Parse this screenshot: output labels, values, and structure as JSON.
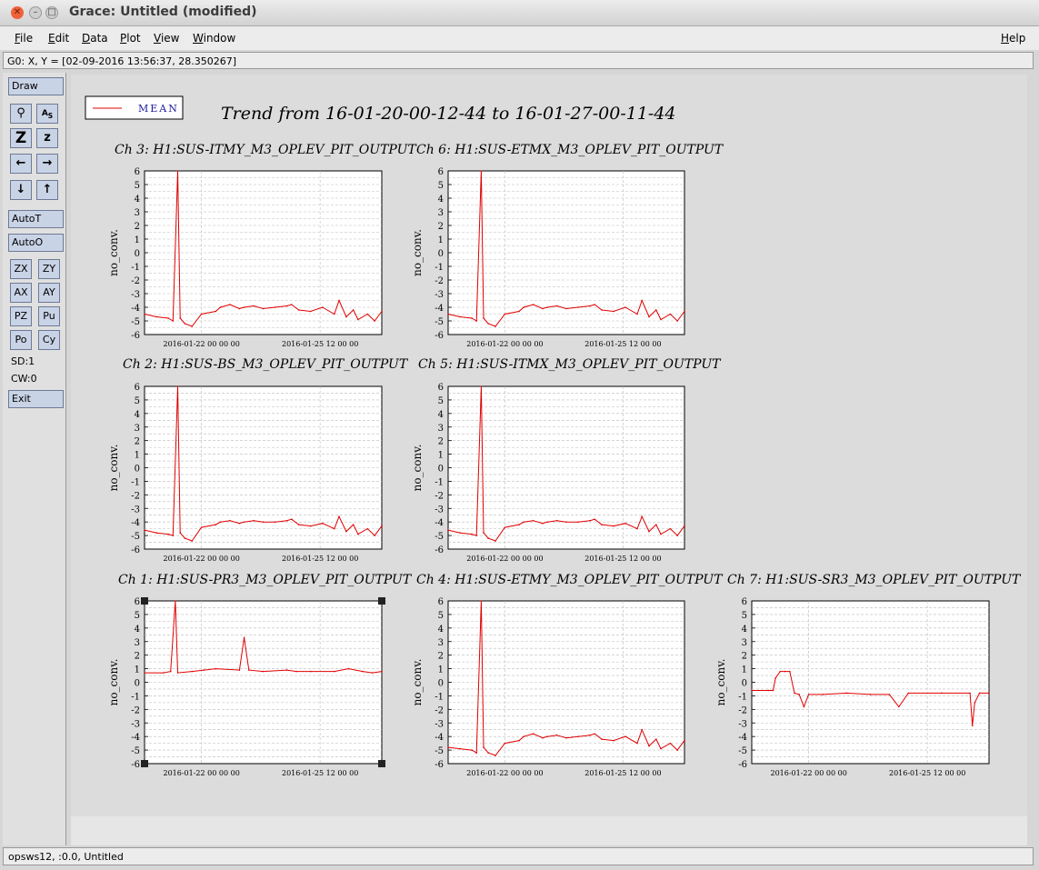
{
  "window": {
    "title": "Grace: Untitled (modified)"
  },
  "menubar": {
    "items": [
      "File",
      "Edit",
      "Data",
      "Plot",
      "View",
      "Window"
    ],
    "help": "Help"
  },
  "coord_readout": "G0: X, Y = [02-09-2016 13:56:37, 28.350267]",
  "toolbar": {
    "draw": "Draw",
    "icon_names": [
      "zoom-icon",
      "text-autoscale-icon",
      "zoom-in-icon",
      "zoom-out-icon",
      "scroll-left-icon",
      "scroll-right-icon",
      "scroll-down-icon",
      "scroll-up-icon"
    ],
    "autot": "AutoT",
    "autoo": "AutoO",
    "buttons": [
      "ZX",
      "ZY",
      "AX",
      "AY",
      "PZ",
      "Pu",
      "Po",
      "Cy"
    ],
    "sd": "SD:1",
    "cw": "CW:0",
    "exit": "Exit"
  },
  "status_bar": "opsws12, :0.0, Untitled",
  "plot": {
    "title": "Trend from 16-01-20-00-12-44 to 16-01-27-00-11-44",
    "legend": "MEAN",
    "line_color": "#e00000",
    "grid_color": "#bbbbbb",
    "y_ticks": [
      "6",
      "5",
      "4",
      "3",
      "2",
      "1",
      "0",
      "-1",
      "-2",
      "-3",
      "-4",
      "-5",
      "-6"
    ],
    "x_ticks": [
      "2016-01-22 00 00 00",
      "2016-01-25 12 00 00"
    ],
    "ylabel": "no_conv."
  },
  "chart_data": [
    {
      "type": "line",
      "title": "Ch 3: H1:SUS-ITMY_M3_OPLEV_PIT_OUTPUT",
      "ylabel": "no_conv.",
      "ylim": [
        -6,
        6
      ],
      "x_ticks": [
        "2016-01-22 00 00 00",
        "2016-01-25 12 00 00"
      ],
      "x": [
        0,
        0.05,
        0.1,
        0.12,
        0.14,
        0.15,
        0.17,
        0.2,
        0.24,
        0.3,
        0.32,
        0.36,
        0.4,
        0.42,
        0.46,
        0.5,
        0.55,
        0.6,
        0.62,
        0.65,
        0.7,
        0.75,
        0.8,
        0.82,
        0.85,
        0.88,
        0.9,
        0.94,
        0.97,
        1.0
      ],
      "series": [
        {
          "name": "MEAN",
          "values": [
            -4.5,
            -4.7,
            -4.8,
            -5.0,
            6.0,
            -4.8,
            -5.2,
            -5.4,
            -4.5,
            -4.3,
            -4.0,
            -3.8,
            -4.1,
            -4.0,
            -3.9,
            -4.1,
            -4.0,
            -3.9,
            -3.8,
            -4.2,
            -4.3,
            -4.0,
            -4.5,
            -3.5,
            -4.7,
            -4.2,
            -4.9,
            -4.5,
            -5.0,
            -4.3
          ]
        }
      ]
    },
    {
      "type": "line",
      "title": "Ch 6: H1:SUS-ETMX_M3_OPLEV_PIT_OUTPUT",
      "ylabel": "no_conv.",
      "ylim": [
        -6,
        6
      ],
      "x_ticks": [
        "2016-01-22 00 00 00",
        "2016-01-25 12 00 00"
      ],
      "x": [
        0,
        0.05,
        0.1,
        0.12,
        0.14,
        0.15,
        0.17,
        0.2,
        0.24,
        0.3,
        0.32,
        0.36,
        0.4,
        0.42,
        0.46,
        0.5,
        0.55,
        0.6,
        0.62,
        0.65,
        0.7,
        0.75,
        0.8,
        0.82,
        0.85,
        0.88,
        0.9,
        0.94,
        0.97,
        1.0
      ],
      "series": [
        {
          "name": "MEAN",
          "values": [
            -4.5,
            -4.7,
            -4.8,
            -5.0,
            6.0,
            -4.8,
            -5.2,
            -5.4,
            -4.5,
            -4.3,
            -4.0,
            -3.8,
            -4.1,
            -4.0,
            -3.9,
            -4.1,
            -4.0,
            -3.9,
            -3.8,
            -4.2,
            -4.3,
            -4.0,
            -4.5,
            -3.5,
            -4.7,
            -4.2,
            -4.9,
            -4.5,
            -5.0,
            -4.3
          ]
        }
      ]
    },
    {
      "type": "line",
      "title": "Ch 2: H1:SUS-BS_M3_OPLEV_PIT_OUTPUT",
      "ylabel": "no_conv.",
      "ylim": [
        -6,
        6
      ],
      "x_ticks": [
        "2016-01-22 00 00 00",
        "2016-01-25 12 00 00"
      ],
      "x": [
        0,
        0.05,
        0.1,
        0.12,
        0.14,
        0.15,
        0.17,
        0.2,
        0.24,
        0.3,
        0.32,
        0.36,
        0.4,
        0.42,
        0.46,
        0.5,
        0.55,
        0.6,
        0.62,
        0.65,
        0.7,
        0.75,
        0.8,
        0.82,
        0.85,
        0.88,
        0.9,
        0.94,
        0.97,
        1.0
      ],
      "series": [
        {
          "name": "MEAN",
          "values": [
            -4.6,
            -4.8,
            -4.9,
            -5.0,
            6.0,
            -4.8,
            -5.2,
            -5.4,
            -4.4,
            -4.2,
            -4.0,
            -3.9,
            -4.1,
            -4.0,
            -3.9,
            -4.0,
            -4.0,
            -3.9,
            -3.8,
            -4.2,
            -4.3,
            -4.1,
            -4.5,
            -3.6,
            -4.7,
            -4.2,
            -4.9,
            -4.5,
            -5.0,
            -4.3
          ]
        }
      ]
    },
    {
      "type": "line",
      "title": "Ch 5: H1:SUS-ITMX_M3_OPLEV_PIT_OUTPUT",
      "ylabel": "no_conv.",
      "ylim": [
        -6,
        6
      ],
      "x_ticks": [
        "2016-01-22 00 00 00",
        "2016-01-25 12 00 00"
      ],
      "x": [
        0,
        0.05,
        0.1,
        0.12,
        0.14,
        0.15,
        0.17,
        0.2,
        0.24,
        0.3,
        0.32,
        0.36,
        0.4,
        0.42,
        0.46,
        0.5,
        0.55,
        0.6,
        0.62,
        0.65,
        0.7,
        0.75,
        0.8,
        0.82,
        0.85,
        0.88,
        0.9,
        0.94,
        0.97,
        1.0
      ],
      "series": [
        {
          "name": "MEAN",
          "values": [
            -4.6,
            -4.8,
            -4.9,
            -5.0,
            6.0,
            -4.8,
            -5.2,
            -5.4,
            -4.4,
            -4.2,
            -4.0,
            -3.9,
            -4.1,
            -4.0,
            -3.9,
            -4.0,
            -4.0,
            -3.9,
            -3.8,
            -4.2,
            -4.3,
            -4.1,
            -4.5,
            -3.6,
            -4.7,
            -4.2,
            -4.9,
            -4.5,
            -5.0,
            -4.3
          ]
        }
      ]
    },
    {
      "type": "line",
      "title": "Ch 1: H1:SUS-PR3_M3_OPLEV_PIT_OUTPUT",
      "ylabel": "no_conv.",
      "ylim": [
        -6,
        6
      ],
      "x_ticks": [
        "2016-01-22 00 00 00",
        "2016-01-25 12 00 00"
      ],
      "x": [
        0,
        0.08,
        0.11,
        0.13,
        0.14,
        0.2,
        0.25,
        0.3,
        0.4,
        0.42,
        0.44,
        0.5,
        0.6,
        0.64,
        0.7,
        0.8,
        0.86,
        0.92,
        0.96,
        1.0
      ],
      "series": [
        {
          "name": "MEAN",
          "values": [
            0.7,
            0.7,
            0.8,
            6.0,
            0.7,
            0.8,
            0.9,
            1.0,
            0.9,
            3.3,
            0.9,
            0.8,
            0.9,
            0.8,
            0.8,
            0.8,
            1.0,
            0.8,
            0.7,
            0.8
          ]
        }
      ]
    },
    {
      "type": "line",
      "title": "Ch 4: H1:SUS-ETMY_M3_OPLEV_PIT_OUTPUT",
      "ylabel": "no_conv.",
      "ylim": [
        -6,
        6
      ],
      "x_ticks": [
        "2016-01-22 00 00 00",
        "2016-01-25 12 00 00"
      ],
      "x": [
        0,
        0.05,
        0.1,
        0.12,
        0.14,
        0.15,
        0.17,
        0.2,
        0.24,
        0.3,
        0.32,
        0.36,
        0.4,
        0.42,
        0.46,
        0.5,
        0.55,
        0.6,
        0.62,
        0.65,
        0.7,
        0.75,
        0.8,
        0.82,
        0.85,
        0.88,
        0.9,
        0.94,
        0.97,
        1.0
      ],
      "series": [
        {
          "name": "MEAN",
          "values": [
            -4.8,
            -4.9,
            -5.0,
            -5.2,
            6.0,
            -4.8,
            -5.2,
            -5.4,
            -4.5,
            -4.3,
            -4.0,
            -3.8,
            -4.1,
            -4.0,
            -3.9,
            -4.1,
            -4.0,
            -3.9,
            -3.8,
            -4.2,
            -4.3,
            -4.0,
            -4.5,
            -3.5,
            -4.7,
            -4.2,
            -4.9,
            -4.5,
            -5.0,
            -4.3
          ]
        }
      ]
    },
    {
      "type": "line",
      "title": "Ch 7: H1:SUS-SR3_M3_OPLEV_PIT_OUTPUT",
      "ylabel": "no_conv.",
      "ylim": [
        -6,
        6
      ],
      "x_ticks": [
        "2016-01-22 00 00 00",
        "2016-01-25 12 00 00"
      ],
      "x": [
        0,
        0.07,
        0.09,
        0.1,
        0.12,
        0.14,
        0.16,
        0.18,
        0.2,
        0.22,
        0.24,
        0.3,
        0.4,
        0.5,
        0.58,
        0.62,
        0.66,
        0.8,
        0.92,
        0.93,
        0.94,
        0.96,
        1.0
      ],
      "series": [
        {
          "name": "MEAN",
          "values": [
            -0.6,
            -0.6,
            -0.6,
            0.3,
            0.8,
            0.8,
            0.8,
            -0.8,
            -0.9,
            -1.8,
            -0.9,
            -0.9,
            -0.8,
            -0.9,
            -0.9,
            -1.8,
            -0.8,
            -0.8,
            -0.8,
            -3.2,
            -1.5,
            -0.8,
            -0.8
          ]
        }
      ]
    }
  ]
}
